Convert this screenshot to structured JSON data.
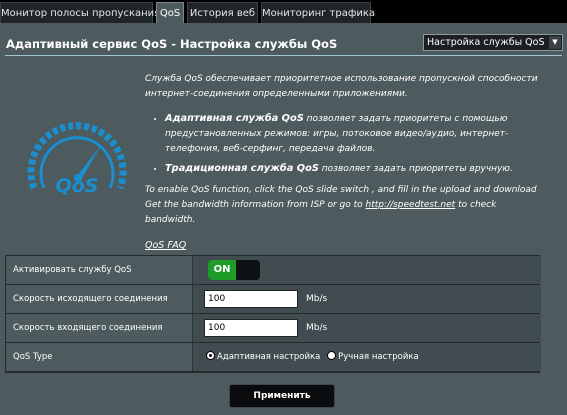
{
  "tabs": [
    {
      "label": "Монитор полосы пропускания"
    },
    {
      "label": "QoS"
    },
    {
      "label": "История веб"
    },
    {
      "label": "Мониторинг трафика"
    }
  ],
  "header": {
    "title": "Адаптивный сервис QoS - Настройка службы QoS",
    "select_value": "Настройка  службы  QoS"
  },
  "logo": {
    "text": "QoS"
  },
  "description": {
    "intro": "Служба QoS обеспечивает приоритетное использование пропускной способности интернет-соединения определенными приложениями.",
    "bullet1_title": "Адаптивная служба QoS",
    "bullet1_text": "позволяет задать приоритеты с помощью предустановленных режимов: игры, потоковое видео/аудио, интернет-телефония, веб-серфинг, передача файлов.",
    "bullet2_title": "Традиционная служба QoS",
    "bullet2_text": "позволяет задать приоритеты вручную.",
    "english_text_1": "To enable QoS function, click the QoS slide switch , and fill in the upload and download Get the bandwidth information from ISP or go to",
    "speedtest_link": "http://speedtest.net",
    "english_text_2": "to check bandwidth.",
    "faq_link": "QoS FAQ"
  },
  "settings": {
    "enable_label": "Активировать службу QoS",
    "toggle_state": "ON",
    "upload_label": "Скорость исходящего соединения",
    "upload_value": "100",
    "upload_unit": "Mb/s",
    "download_label": "Скорость входящего соединения",
    "download_value": "100",
    "download_unit": "Mb/s",
    "type_label": "QoS Type",
    "type_option_adaptive": "Адаптивная настройка",
    "type_option_manual": "Ручная настройка",
    "type_selected": "adaptive"
  },
  "apply_button": "Применить",
  "colors": {
    "accent": "#1e9c2a",
    "logo": "#1a8fd0",
    "background": "#4d5a5e"
  }
}
